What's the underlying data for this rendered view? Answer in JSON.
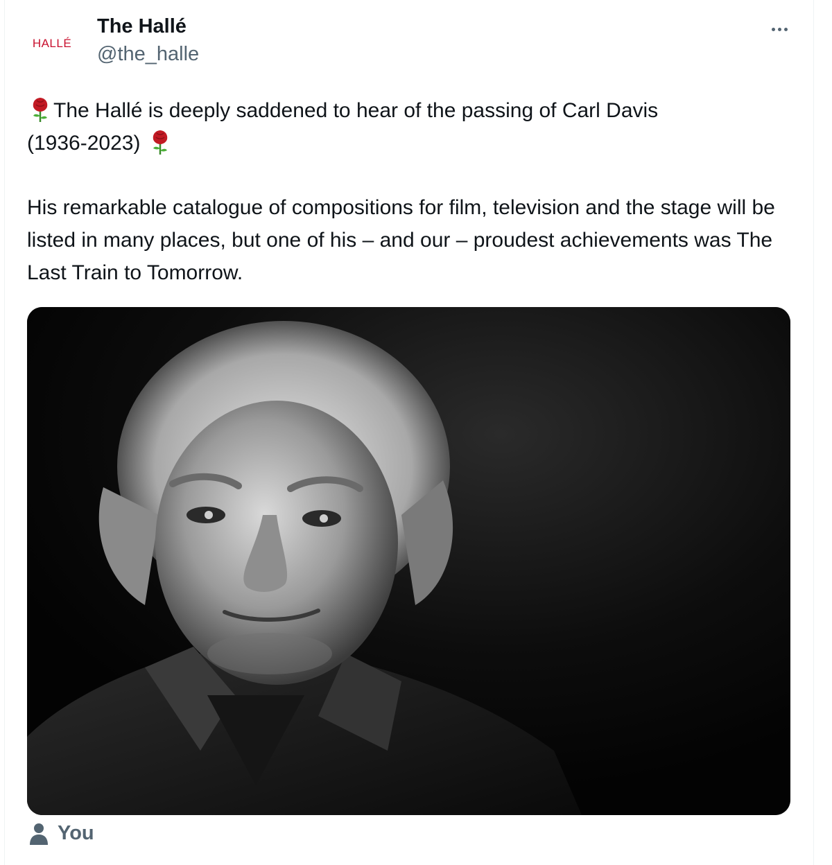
{
  "account": {
    "avatar_text": "HALLÉ",
    "display_name": "The Hallé",
    "handle": "@the_halle"
  },
  "menu": {
    "icon": "more-horizontal-icon"
  },
  "tweet": {
    "line1_a": "The Hallé is deeply saddened to hear of the passing of Carl Davis",
    "line1_b": "(1936-2023)",
    "emoji": "rose-icon",
    "paragraph2": "His remarkable catalogue of compositions for film, television and the stage will be listed in many places, but one of his – and our – proudest achievements was The Last Train to Tomorrow."
  },
  "media": {
    "kind": "black-and-white portrait photo"
  },
  "tagged": {
    "icon": "person-icon",
    "label": "You"
  },
  "colors": {
    "brand_red": "#c8102e",
    "secondary_text": "#536471",
    "primary_text": "#0f1419"
  }
}
